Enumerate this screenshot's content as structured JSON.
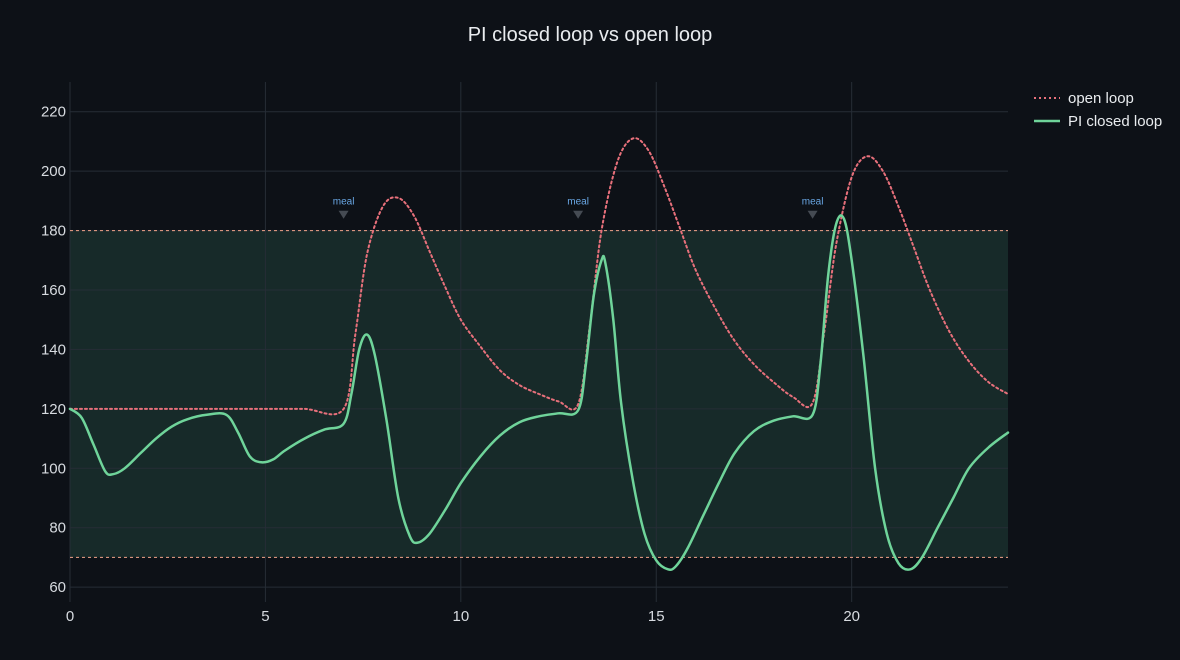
{
  "chart_data": {
    "type": "line",
    "title": "PI closed loop vs open loop",
    "xlabel": "",
    "ylabel": "",
    "xlim": [
      0,
      24
    ],
    "ylim": [
      55,
      230
    ],
    "xticks": [
      0,
      5,
      10,
      15,
      20
    ],
    "yticks": [
      60,
      80,
      100,
      120,
      140,
      160,
      180,
      200,
      220
    ],
    "grid": true,
    "legend_position": "top-right",
    "target_band": [
      70,
      180
    ],
    "annotations": [
      {
        "x": 7.0,
        "y": 186,
        "text": "meal"
      },
      {
        "x": 13.0,
        "y": 186,
        "text": "meal"
      },
      {
        "x": 19.0,
        "y": 186,
        "text": "meal"
      }
    ],
    "series": [
      {
        "name": "open loop",
        "style": "dotted",
        "color": "#e8707b",
        "x": [
          0,
          1,
          2,
          3,
          4,
          5,
          6,
          7.0,
          7.3,
          7.6,
          8.0,
          8.4,
          8.8,
          9.2,
          9.6,
          10.0,
          10.5,
          11.0,
          11.5,
          12.0,
          12.5,
          13.0,
          13.3,
          13.6,
          14.0,
          14.4,
          14.8,
          15.2,
          15.6,
          16.0,
          16.5,
          17.0,
          17.5,
          18.0,
          18.5,
          19.0,
          19.3,
          19.6,
          20.0,
          20.4,
          20.8,
          21.2,
          21.6,
          22.0,
          22.5,
          23.0,
          23.5,
          24.0
        ],
        "values": [
          120,
          120,
          120,
          120,
          120,
          120,
          120,
          120,
          145,
          172,
          188,
          191,
          185,
          173,
          161,
          150,
          141,
          133,
          128,
          125,
          122.5,
          121.5,
          148,
          180,
          203,
          211,
          207,
          195,
          181,
          167,
          154,
          143,
          135,
          129,
          124,
          122,
          146,
          175,
          198,
          205,
          200,
          188,
          174,
          160,
          146,
          136,
          129,
          125
        ]
      },
      {
        "name": "PI closed loop",
        "style": "solid",
        "color": "#6fd49a",
        "x": [
          0,
          0.3,
          0.6,
          0.9,
          1.1,
          1.4,
          1.8,
          2.2,
          2.6,
          3.0,
          3.5,
          4.0,
          4.3,
          4.6,
          4.9,
          5.2,
          5.5,
          6.0,
          6.5,
          7.0,
          7.2,
          7.4,
          7.6,
          7.8,
          8.1,
          8.4,
          8.7,
          8.9,
          9.2,
          9.6,
          10.0,
          10.5,
          11.0,
          11.5,
          12.0,
          12.5,
          13.0,
          13.2,
          13.4,
          13.6,
          13.7,
          13.9,
          14.1,
          14.4,
          14.7,
          15.0,
          15.3,
          15.5,
          15.8,
          16.2,
          16.6,
          17.0,
          17.5,
          18.0,
          18.5,
          19.0,
          19.2,
          19.4,
          19.6,
          19.8,
          20.0,
          20.3,
          20.6,
          20.9,
          21.2,
          21.5,
          21.8,
          22.2,
          22.6,
          23.0,
          23.5,
          24.0
        ],
        "values": [
          120,
          117,
          108,
          99,
          98,
          100,
          105,
          110,
          114,
          116.5,
          118,
          118,
          112,
          104,
          102,
          103,
          106,
          110,
          113,
          115,
          125,
          140,
          145,
          138,
          116,
          90,
          77,
          75,
          78,
          86,
          95,
          104,
          111,
          115.5,
          117.5,
          118.5,
          119.5,
          135,
          158,
          170,
          169,
          150,
          122,
          96,
          78,
          69,
          66,
          67,
          73,
          84,
          95,
          105,
          112.5,
          116,
          117.5,
          118,
          135,
          165,
          182,
          184,
          170,
          138,
          100,
          78,
          68,
          66,
          70,
          80,
          90,
          100,
          107,
          112
        ]
      }
    ]
  },
  "colors": {
    "background": "#0d1117",
    "band": "#172a29",
    "band_edge": "#f2a58a",
    "grid": "#262d36",
    "marker": "#454b53"
  }
}
